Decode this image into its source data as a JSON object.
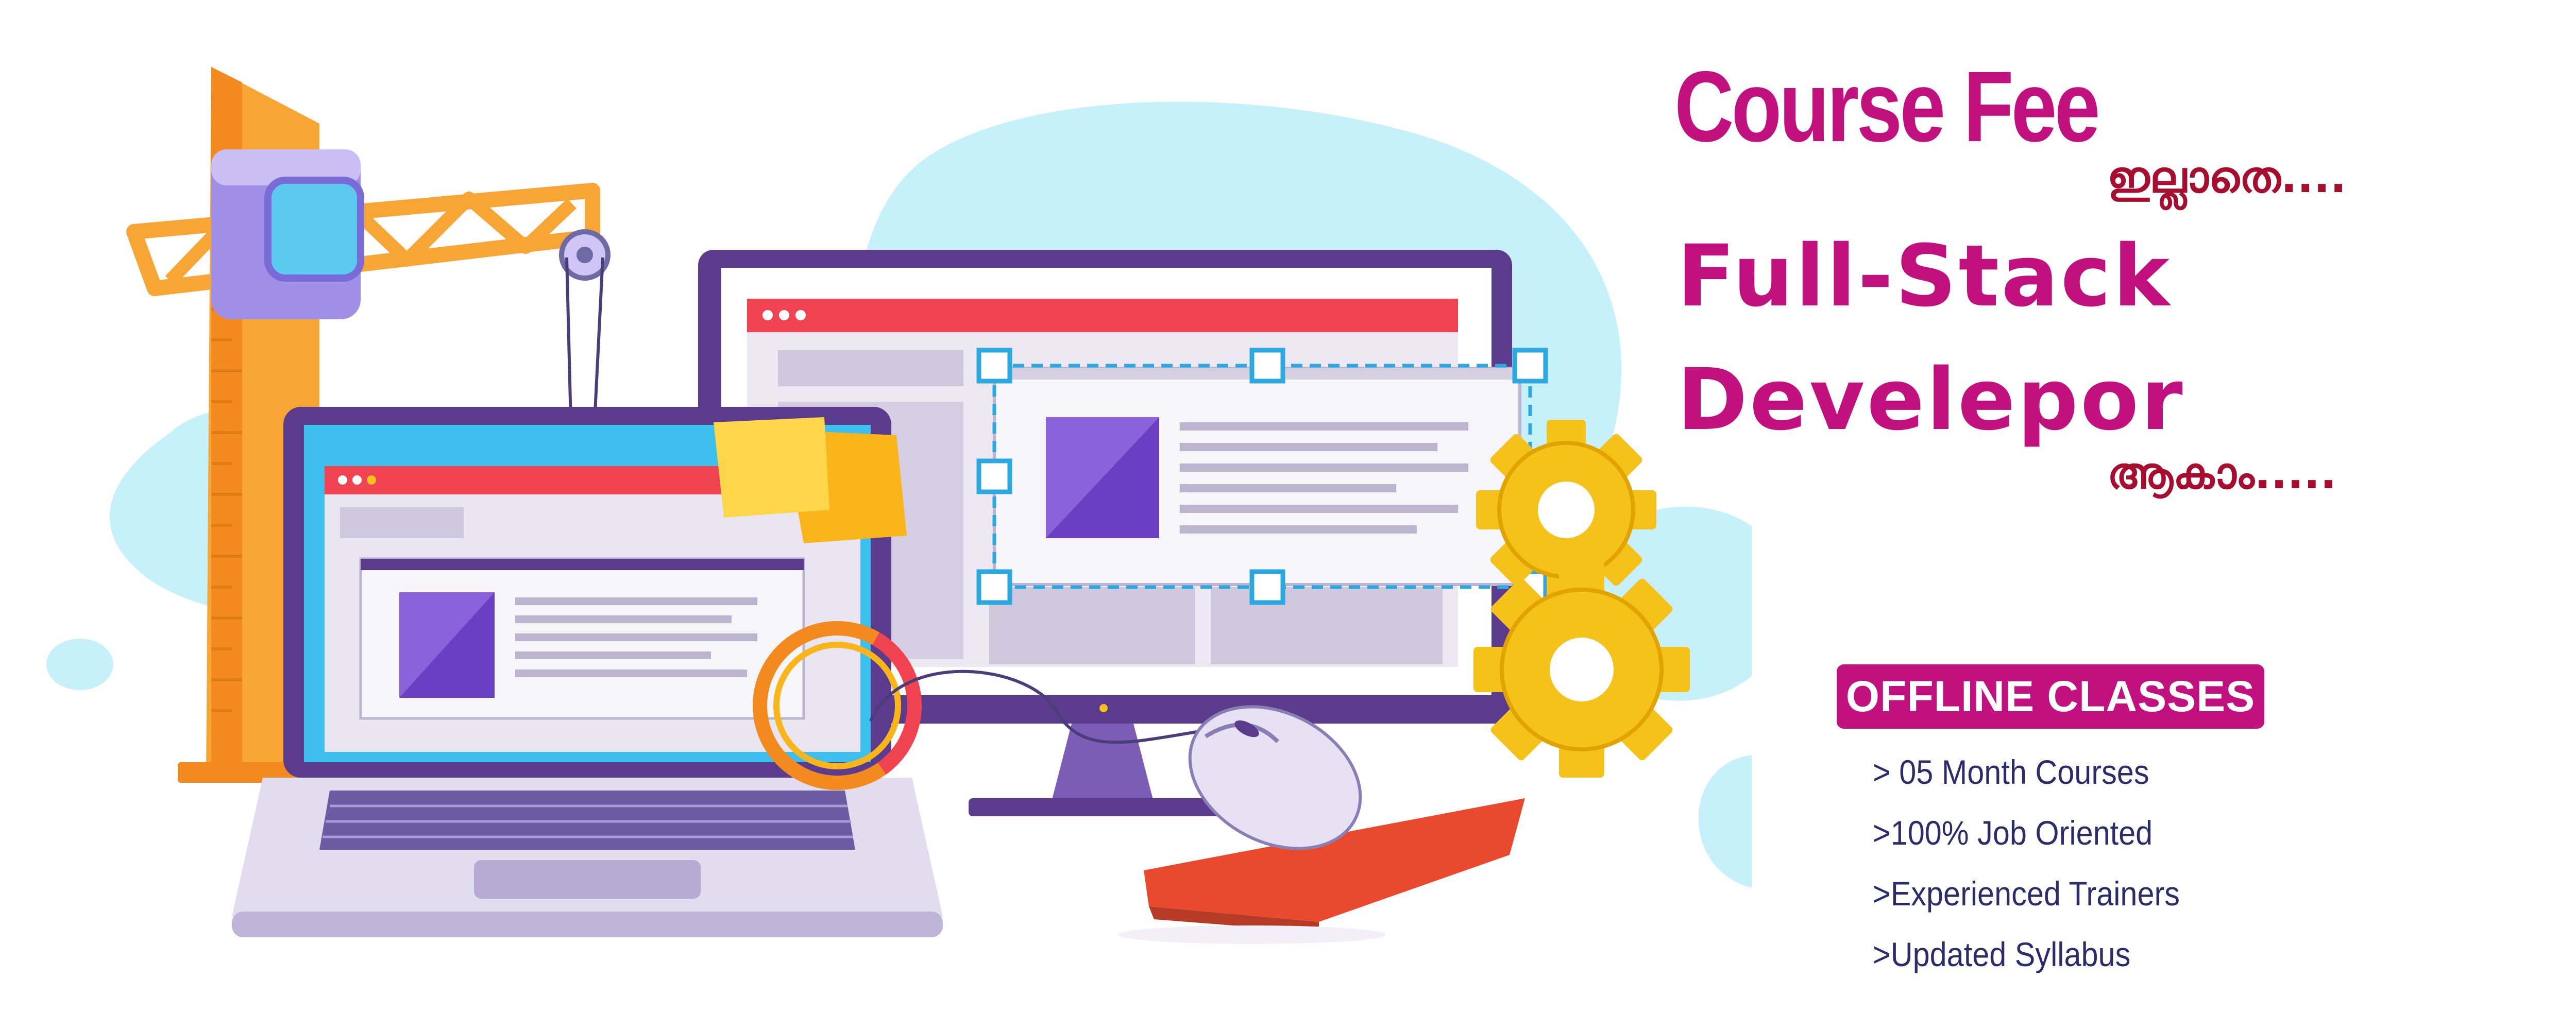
{
  "headline": {
    "line1": "Course Fee",
    "line1_suffix": "ഇല്ലാതെ....",
    "line2": "Full-Stack",
    "line3": "Develepor",
    "line3_suffix": "ആകാം....."
  },
  "badge": {
    "label": "OFFLINE CLASSES"
  },
  "features": [
    "> 05 Month Courses",
    ">100% Job Oriented",
    ">Experienced Trainers",
    ">Updated Syllabus"
  ],
  "colors": {
    "magenta": "#c0117f",
    "maroon": "#a60d2e",
    "navy": "#2b2d6b",
    "sky": "#c6f0fa",
    "gear": "#f5c21b",
    "crane": "#f7a535",
    "red_bar": "#ef4352",
    "purple": "#6a3fc1"
  },
  "illustration": {
    "icons": [
      "crane-icon",
      "laptop-icon",
      "monitor-icon",
      "gear-icon",
      "mouse-icon",
      "sticky-note-icon",
      "donut-chart-icon"
    ]
  }
}
